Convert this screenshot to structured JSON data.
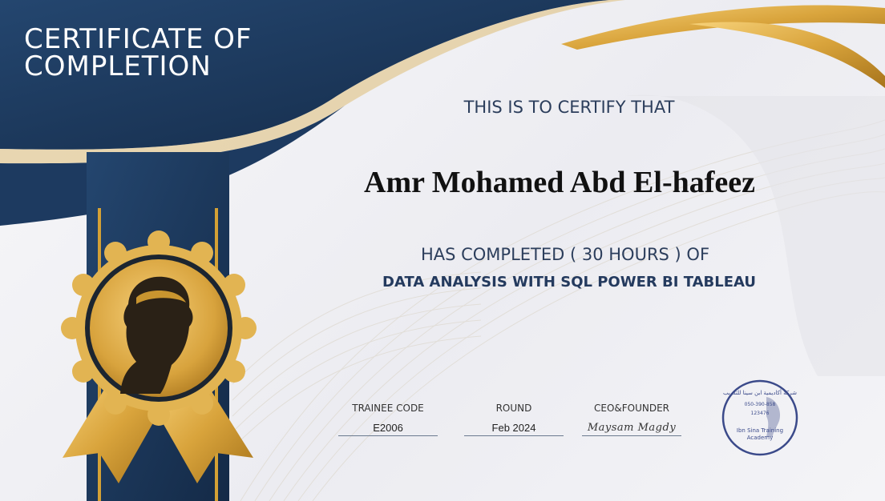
{
  "certificate": {
    "title_line1": "CERTIFICATE OF",
    "title_line2": "COMPLETION",
    "certify_text": "THIS IS TO CERTIFY THAT",
    "recipient_name": "Amr Mohamed Abd El-hafeez",
    "completed_text": "HAS COMPLETED ( 30 HOURS ) OF",
    "course_name": "DATA ANALYSIS WITH SQL POWER BI TABLEAU"
  },
  "fields": {
    "trainee_code_label": "TRAINEE CODE",
    "trainee_code_value": "E2006",
    "round_label": "ROUND",
    "round_value": "Feb 2024",
    "founder_label": "CEO&FOUNDER",
    "founder_signature": "Maysam Magdy"
  },
  "stamp": {
    "arabic_name": "شركة أكاديمية ابن سينا للتدريب",
    "phone": "050-390-858",
    "number": "123476",
    "english_line1": "Ibn Sina Training",
    "english_line2": "Academy"
  },
  "colors": {
    "navy": "#1b3558",
    "gold": "#d4a135",
    "text": "#2c3e5c"
  },
  "icons": {
    "seal": "gold-medal-with-portrait",
    "stamp": "circular-company-stamp"
  }
}
